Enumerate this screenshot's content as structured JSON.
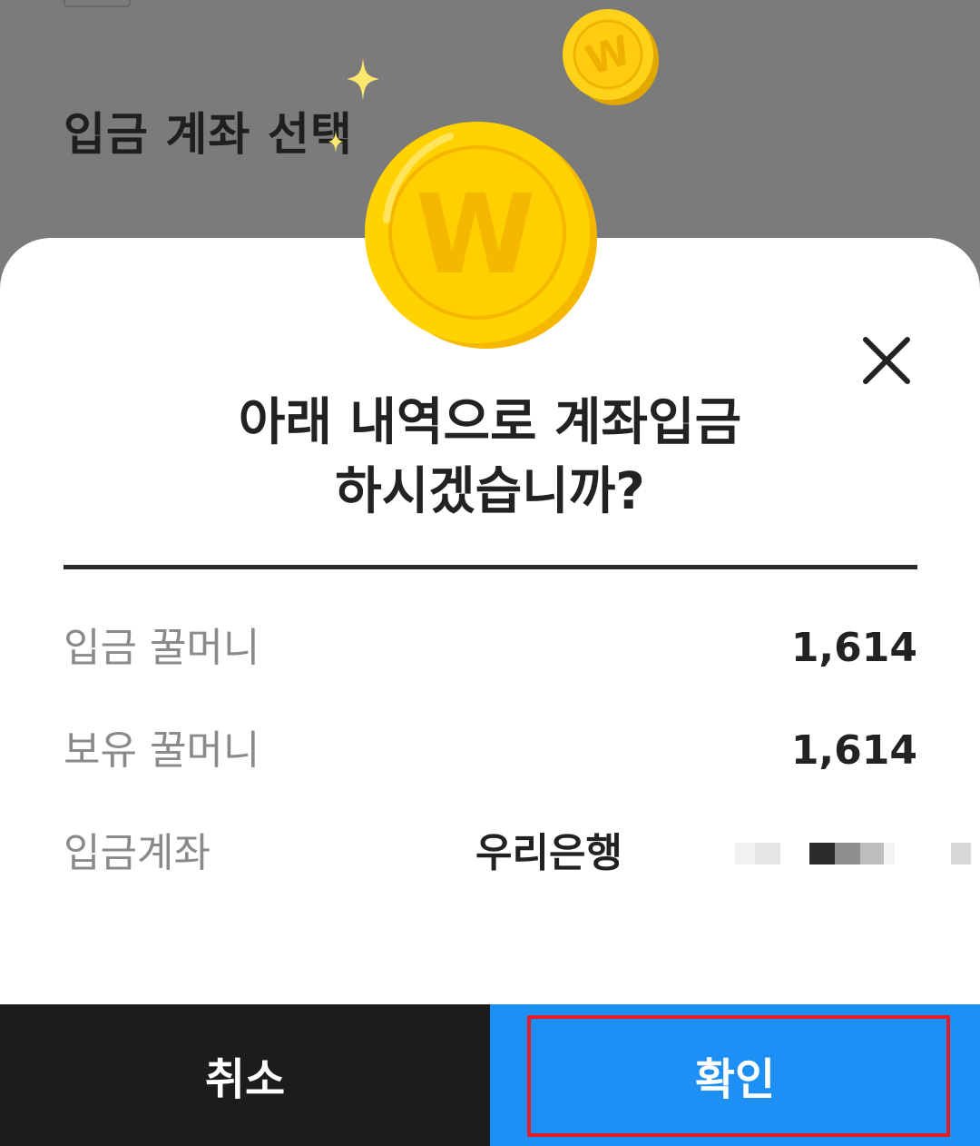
{
  "background": {
    "title": "입금 계좌 선택"
  },
  "dialog": {
    "title_line1": "아래 내역으로 계좌입금",
    "title_line2": "하시겠습니까?",
    "rows": [
      {
        "label": "입금 꿀머니",
        "value": "1,614"
      },
      {
        "label": "보유 꿀머니",
        "value": "1,614"
      },
      {
        "label": "입금계좌",
        "bank": "우리은행",
        "account": "(blurred)"
      }
    ],
    "coin_letter": "W"
  },
  "buttons": {
    "cancel_label": "취소",
    "confirm_label": "확인"
  },
  "colors": {
    "dim_overlay": "#7b7b7b",
    "sheet": "#ffffff",
    "cancel_bg": "#1b1c1e",
    "confirm_bg": "#1e8ff5",
    "coin_gold": "#ffd21a",
    "highlight_border": "#e21e24"
  },
  "icons": {
    "close": "close-icon",
    "coin": "coin-icon",
    "sparkle": "sparkle-icon"
  }
}
